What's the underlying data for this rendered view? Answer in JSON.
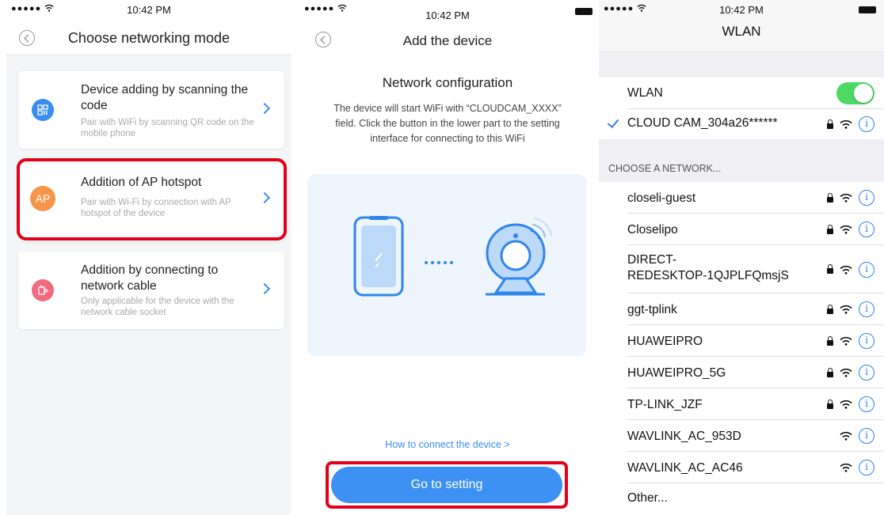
{
  "status": {
    "time": "10:42 PM",
    "signal": "●●●●●"
  },
  "screen1": {
    "title": "Choose networking mode",
    "cards": [
      {
        "title": "Device adding by scanning the code",
        "desc": "Pair with WiFi by scanning QR code on the mobile phone",
        "icon": "qr-code-icon",
        "color": "#3a8df0"
      },
      {
        "title": "Addition of AP hotspot",
        "desc": "Pair with Wi-Fi by connection with AP hotspot of the device",
        "icon_text": "AP",
        "color": "#f7964a"
      },
      {
        "title": "Addition by connecting to network cable",
        "desc": "Only applicable for the device with the network cable socket",
        "icon": "network-cable-icon",
        "color": "#f26a7f"
      }
    ]
  },
  "screen2": {
    "title": "Add the device",
    "subtitle": "Network configuration",
    "description": "The device will start WiFi with “CLOUDCAM_XXXX” field. Click the button in the lower part to the setting interface for connecting to this WiFi",
    "help_link": "How to connect the device  >",
    "button": "Go to setting"
  },
  "screen3": {
    "title": "WLAN",
    "wlan_label": "WLAN",
    "wlan_on": true,
    "connected": "CLOUD CAM_304a26******",
    "section_header": "CHOOSE A NETWORK...",
    "networks": [
      {
        "name": "closeli-guest",
        "locked": true
      },
      {
        "name": "Closelipo",
        "locked": true
      },
      {
        "name": "DIRECT-\nREDESKTOP-1QJPLFQmsjS",
        "locked": true
      },
      {
        "name": "ggt-tplink",
        "locked": true
      },
      {
        "name": "HUAWEIPRO",
        "locked": true
      },
      {
        "name": "HUAWEIPRO_5G",
        "locked": true
      },
      {
        "name": "TP-LINK_JZF",
        "locked": true
      },
      {
        "name": "WAVLINK_AC_953D",
        "locked": false
      },
      {
        "name": "WAVLINK_AC_AC46",
        "locked": false
      }
    ],
    "other": "Other...",
    "info_glyph": "i"
  },
  "colors": {
    "accent": "#3a8df0",
    "highlight": "#e2001a",
    "toggle_on": "#4cd964"
  }
}
